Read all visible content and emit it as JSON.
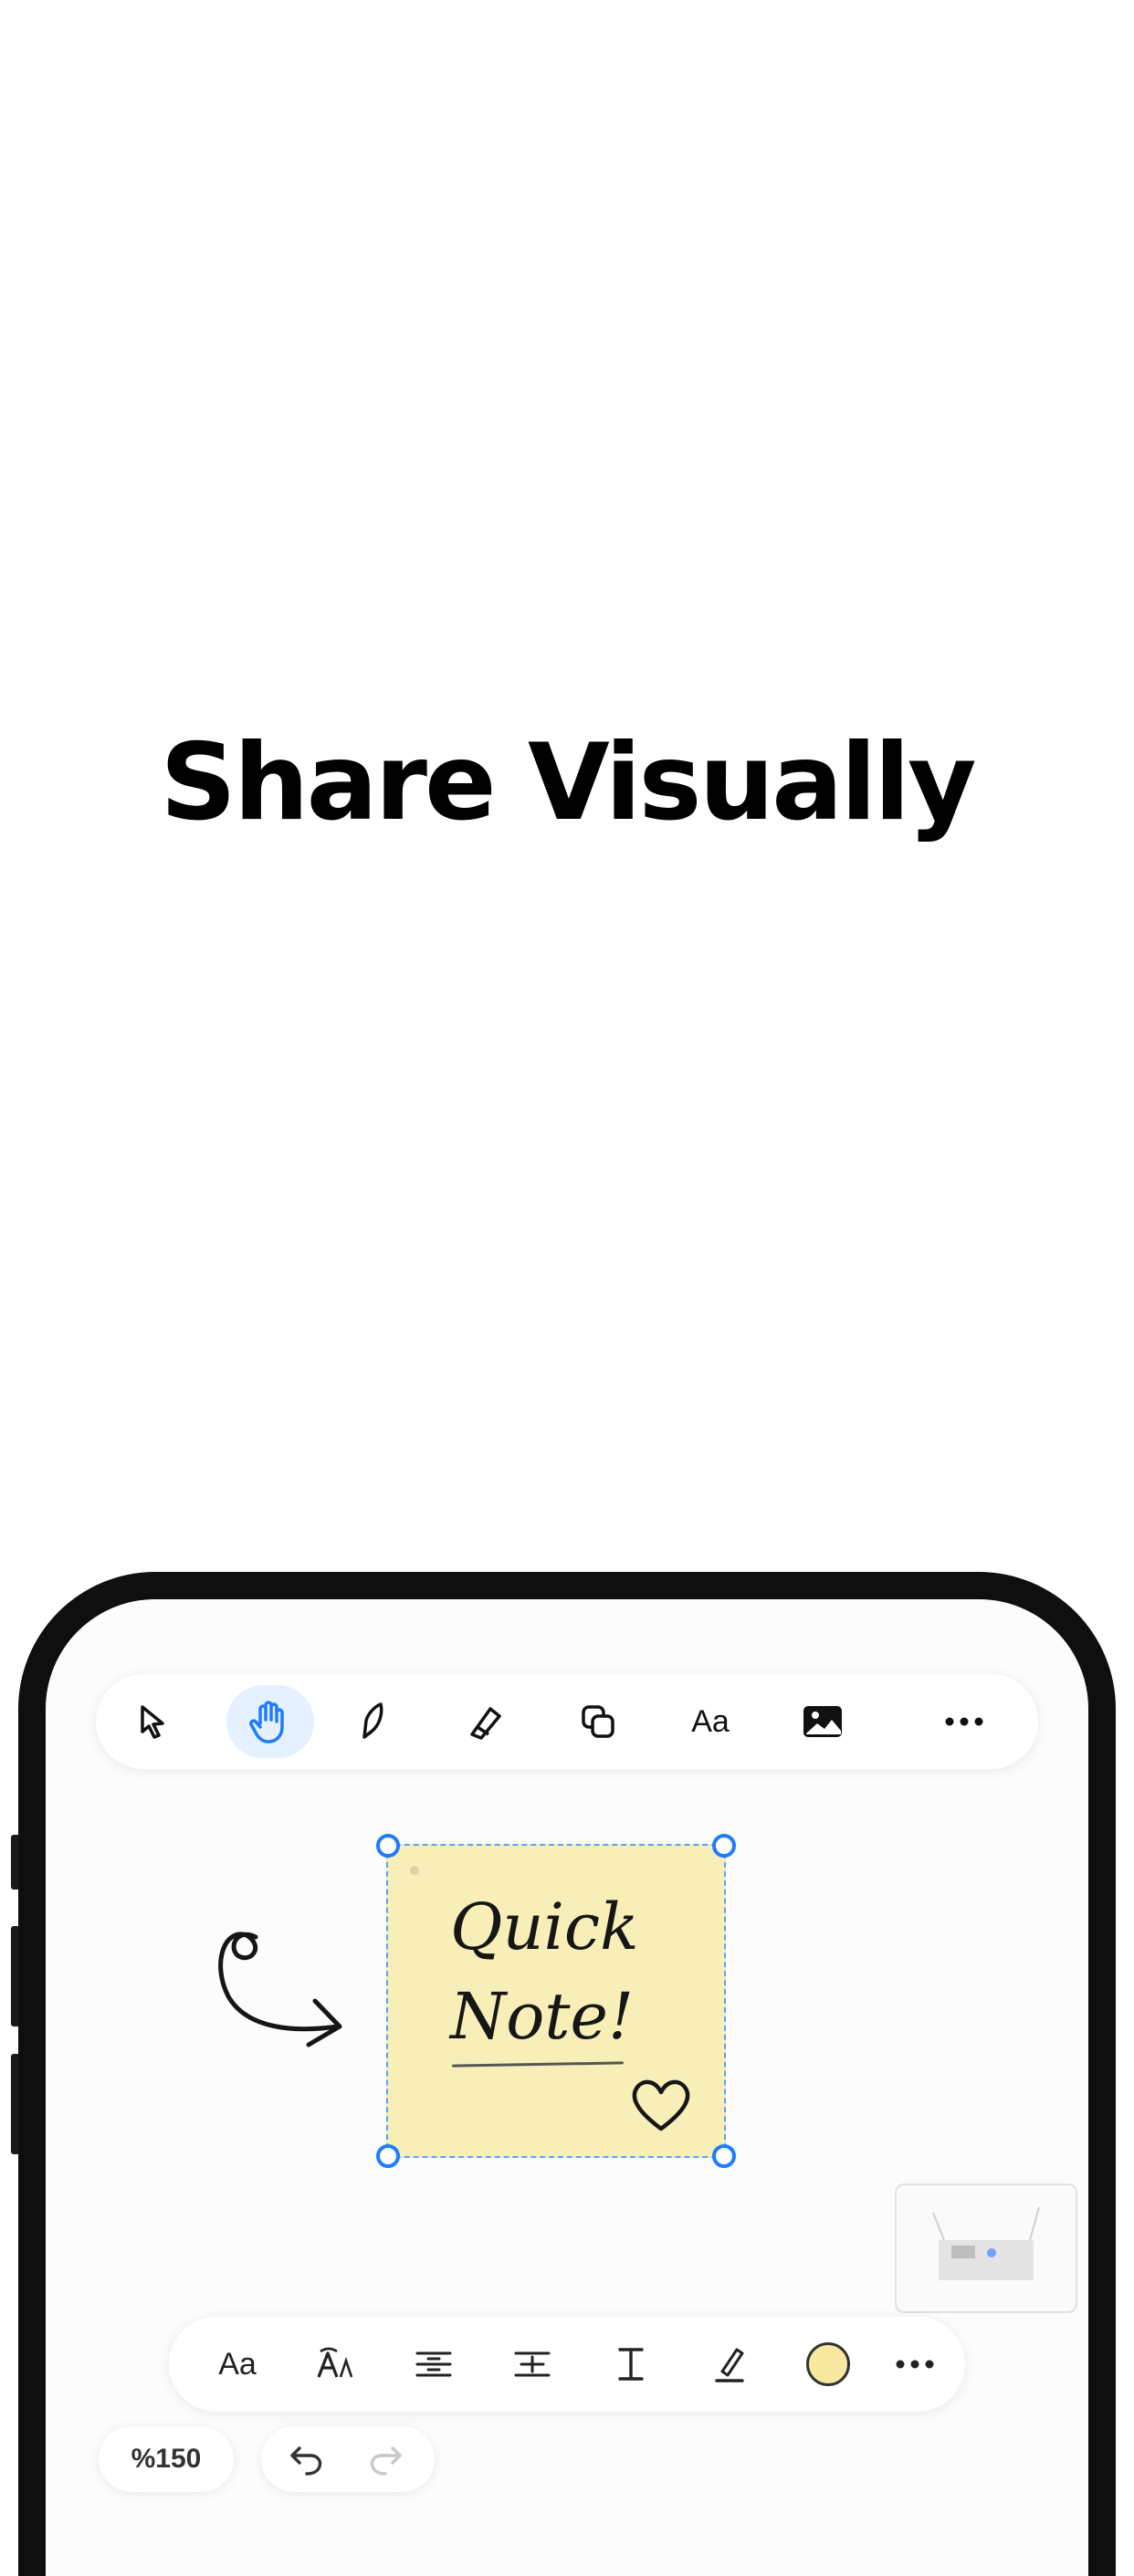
{
  "headline": "Share Visually",
  "top_toolbar": {
    "tools": [
      {
        "name": "select",
        "icon": "cursor-icon"
      },
      {
        "name": "hand",
        "icon": "hand-icon",
        "active": true
      },
      {
        "name": "pen",
        "icon": "pen-icon"
      },
      {
        "name": "eraser",
        "icon": "eraser-icon"
      },
      {
        "name": "shapes",
        "icon": "shapes-icon"
      },
      {
        "name": "text",
        "label": "Aa"
      },
      {
        "name": "image",
        "icon": "image-icon"
      },
      {
        "name": "more",
        "icon": "more-icon"
      }
    ],
    "text_label": "Aa"
  },
  "sticky_note": {
    "line1": "Quick",
    "line2": "Note!",
    "color": "#f8efb8",
    "selection_color": "#1f7cff"
  },
  "bottom_toolbar": {
    "font_label": "Aa",
    "color_swatch": "#f9e9a0",
    "tools": [
      "font",
      "text-style",
      "align-left",
      "align-center",
      "text-cursor",
      "highlight",
      "color",
      "more"
    ]
  },
  "zoom_label": "%150",
  "colors": {
    "accent": "#1f7cff",
    "active_bg": "#e5f1ff"
  }
}
